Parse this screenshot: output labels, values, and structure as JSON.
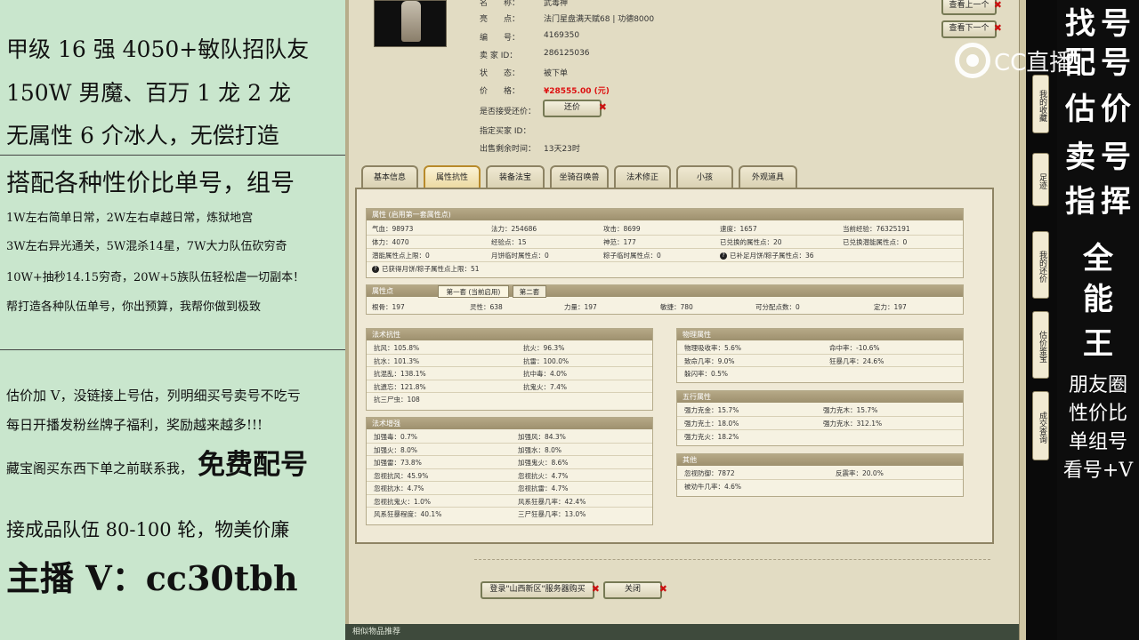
{
  "left_panel": {
    "lines_top": [
      "甲级 16 强 4050+敏队招队友",
      "150W 男魔、百万 1 龙 2 龙",
      "无属性 6 介冰人，无偿打造"
    ],
    "heading": "搭配各种性价比单号，组号",
    "lines_small": [
      "1W左右简单日常，2W左右卓越日常，炼狱地宫",
      "3W左右异光通关，5W混杀14星，7W大力队伍砍穷奇",
      "10W+抽秒14.15穷奇，20W+5族队伍轻松虐一切副本！",
      "帮打造各种队伍单号，你出预算，我帮你做到极致"
    ],
    "lines_mid": [
      "估价加 V，没链接上号估，列明细买号卖号不吃亏",
      "每日开播发粉丝牌子福利，奖励越来越多!!!"
    ],
    "contact_prefix": "藏宝阁买东西下单之前联系我，",
    "contact_big": "免费配号",
    "team_line": "接成品队伍 80-100 轮，物美价廉",
    "anchor_line": "主播 V：cc30tbh"
  },
  "listing": {
    "rows": [
      {
        "label": "名　　称：",
        "value": "武毒神"
      },
      {
        "label": "亮　　点：",
        "value": "法门星盘满天赋68 | 功德8000"
      },
      {
        "label": "编　　号：",
        "value": "4169350"
      },
      {
        "label": "卖 家 ID：",
        "value": "286125036"
      },
      {
        "label": "状　　态：",
        "value": "被下单"
      }
    ],
    "price_label": "价　　格：",
    "price_value": "¥28555.00 (元)",
    "counter_label": "是否接受还价：",
    "counter_button": "还价",
    "buyer_label": "指定买家 ID：",
    "buyer_value": "",
    "time_label": "出售剩余时间：",
    "time_value": "13天23时",
    "prev_button": "查看上一个",
    "next_button": "查看下一个"
  },
  "tabs": [
    "基本信息",
    "属性抗性",
    "装备法宝",
    "坐骑召唤兽",
    "法术修正",
    "小孩",
    "外观道具"
  ],
  "active_tab": "属性抗性",
  "attributes": {
    "title": "属性 (启用第一套属性点)",
    "rows": [
      [
        "气血：98973",
        "法力：254686",
        "攻击：8699",
        "速度：1657",
        "当前经验：76325191"
      ],
      [
        "体力：4070",
        "经验点：15",
        "神范：177",
        "已兑换的属性点：20",
        "已兑换潜能属性点：0"
      ],
      [
        "潜能属性点上限：0",
        "月饼临时属性点：0",
        "粽子临时属性点：0",
        "已补足月饼/粽子属性点：36",
        ""
      ],
      [
        "已获得月饼/粽子属性点上限：51",
        "",
        "",
        "",
        ""
      ]
    ]
  },
  "points": {
    "title": "属性点",
    "subtab1": "第一套 (当前启用)",
    "subtab2": "第二套",
    "values": [
      "根骨：197",
      "灵性：638",
      "力量：197",
      "敏捷：780",
      "可分配点数：0",
      "定力：197"
    ]
  },
  "magic_resist": {
    "title": "法术抗性",
    "rows": [
      [
        "抗风：105.8%",
        "抗火：96.3%"
      ],
      [
        "抗水：101.3%",
        "抗雷：100.0%"
      ],
      [
        "抗混乱：138.1%",
        "抗中毒：4.0%"
      ],
      [
        "抗遗忘：121.8%",
        "抗鬼火：7.4%"
      ],
      [
        "抗三尸虫：108",
        ""
      ]
    ]
  },
  "magic_boost": {
    "title": "法术增强",
    "rows": [
      [
        "加强毒：0.7%",
        "加强风：84.3%"
      ],
      [
        "加强火：8.0%",
        "加强水：8.0%"
      ],
      [
        "加强雷：73.8%",
        "加强鬼火：8.6%"
      ],
      [
        "忽视抗风：45.9%",
        "忽视抗火：4.7%"
      ],
      [
        "忽视抗水：4.7%",
        "忽视抗雷：4.7%"
      ],
      [
        "忽视抗鬼火：1.0%",
        "风系狂暴几率：42.4%"
      ],
      [
        "风系狂暴程度：40.1%",
        "三尸狂暴几率：13.0%"
      ]
    ]
  },
  "physical": {
    "title": "物理属性",
    "rows": [
      [
        "物理吸收率：5.6%",
        "命中率：-10.6%"
      ],
      [
        "致命几率：9.0%",
        "狂暴几率：24.6%"
      ],
      [
        "躲闪率：0.5%",
        ""
      ]
    ]
  },
  "five_elements": {
    "title": "五行属性",
    "rows": [
      [
        "强力克金：15.7%",
        "强力克木：15.7%"
      ],
      [
        "强力克土：18.0%",
        "强力克水：312.1%"
      ],
      [
        "强力克火：18.2%",
        ""
      ]
    ]
  },
  "other": {
    "title": "其他",
    "rows": [
      [
        "忽视防御：7872",
        "反震率：20.0%"
      ],
      [
        "被劝牛几率：4.6%",
        ""
      ]
    ]
  },
  "bottom_buttons": {
    "login": "登录\"山西新区\"服务器购买",
    "close": "关闭"
  },
  "bottom_strip": "相似物品推荐",
  "side_tabs": [
    "我的收藏",
    "足迹",
    "我的还价",
    "估价鉴宝",
    "成交查询"
  ],
  "logo_text": "CC直播",
  "right_overlay": {
    "big_chars": [
      "找",
      "号",
      "配",
      "号",
      "估",
      "价",
      "卖",
      "号",
      "指",
      "挥",
      "全",
      "能",
      "王"
    ],
    "small_lines": [
      "朋友圈",
      "性价比",
      "单组号",
      "看号+V"
    ]
  }
}
